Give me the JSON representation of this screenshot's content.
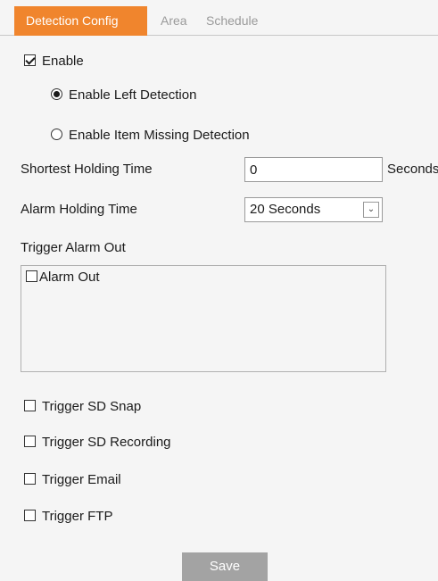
{
  "tabs": [
    {
      "label": "Detection Config",
      "active": true
    },
    {
      "label": "Area",
      "active": false
    },
    {
      "label": "Schedule",
      "active": false
    }
  ],
  "enable": {
    "label": "Enable",
    "checked": true
  },
  "modes": [
    {
      "label": "Enable Left Detection",
      "selected": true
    },
    {
      "label": "Enable Item Missing Detection",
      "selected": false
    }
  ],
  "shortest_holding": {
    "label": "Shortest Holding Time",
    "value": "0",
    "unit": "Seconds"
  },
  "alarm_holding": {
    "label": "Alarm Holding Time",
    "value": "20 Seconds"
  },
  "trigger_alarm_out": {
    "label": "Trigger Alarm Out",
    "items": [
      {
        "label": "Alarm Out",
        "checked": false
      }
    ]
  },
  "triggers": [
    {
      "label": "Trigger SD Snap",
      "checked": false
    },
    {
      "label": "Trigger SD Recording",
      "checked": false
    },
    {
      "label": "Trigger Email",
      "checked": false
    },
    {
      "label": "Trigger FTP",
      "checked": false
    }
  ],
  "save_label": "Save",
  "colors": {
    "accent": "#f0852d",
    "button": "#a3a3a3",
    "background": "#f5f5f5"
  }
}
